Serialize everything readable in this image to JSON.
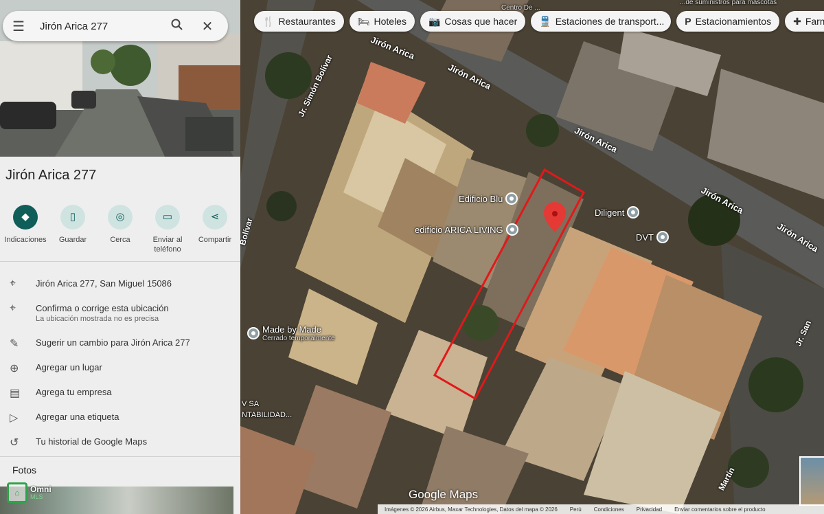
{
  "search": {
    "query": "Jirón Arica 277"
  },
  "place": {
    "title": "Jirón Arica 277"
  },
  "actions": [
    {
      "icon": "directions-icon",
      "label": "Indicaciones"
    },
    {
      "icon": "bookmark-icon",
      "label": "Guardar"
    },
    {
      "icon": "nearby-icon",
      "label": "Cerca"
    },
    {
      "icon": "send-to-phone-icon",
      "label": "Enviar al teléfono"
    },
    {
      "icon": "share-icon",
      "label": "Compartir"
    }
  ],
  "info": {
    "address": "Jirón Arica 277, San Miguel 15086",
    "confirm_title": "Confirma o corrige esta ubicación",
    "confirm_sub": "La ubicación mostrada no es precisa",
    "suggest": "Sugerir un cambio para Jirón Arica 277",
    "add_place": "Agregar un lugar",
    "add_business": "Agrega tu empresa",
    "add_label": "Agregar una etiqueta",
    "history": "Tu historial de Google Maps"
  },
  "photos": {
    "title": "Fotos"
  },
  "watermark_logo": {
    "name": "Omni",
    "sub": "MLS"
  },
  "chips": [
    {
      "icon": "restaurant-icon",
      "label": "Restaurantes"
    },
    {
      "icon": "hotel-icon",
      "label": "Hoteles"
    },
    {
      "icon": "camera-icon",
      "label": "Cosas que hacer"
    },
    {
      "icon": "transit-icon",
      "label": "Estaciones de transport..."
    },
    {
      "icon": "parking-icon",
      "label": "Estacionamientos"
    },
    {
      "icon": "pharmacy-icon",
      "label": "Farm"
    }
  ],
  "map": {
    "streets": {
      "arica_1": "Jirón Arica",
      "arica_2": "Jirón Arica",
      "arica_3": "Jirón Arica",
      "arica_4": "Jirón Arica",
      "arica_5": "Jirón Arica",
      "bolivar": "Jr. Simón Bolívar",
      "bolivar_cut": "Bolívar",
      "san_martin": "Jr. San",
      "martin": "Martín"
    },
    "pois": {
      "blu": "Edificio Blu",
      "arica_living": "edificio ARICA LIVING",
      "diligent": "Diligent",
      "dvt": "DVT",
      "made_by_made": "Made by Made",
      "made_by_made_status": "Cerrado temporalmente",
      "cut_label_1": "V SA",
      "cut_label_2": "NTABILIDAD..."
    },
    "top_text": "Centro De ...",
    "top_right_text": "...de suministros para mascotas",
    "brand": "Google Maps",
    "footer": [
      "Imágenes © 2026 Airbus, Maxar Technologies, Datos del mapa © 2026",
      "Perú",
      "Condiciones",
      "Privacidad",
      "Enviar comentarios sobre el producto"
    ],
    "marker_color": "#e53935",
    "outline_color": "#e0191b"
  }
}
